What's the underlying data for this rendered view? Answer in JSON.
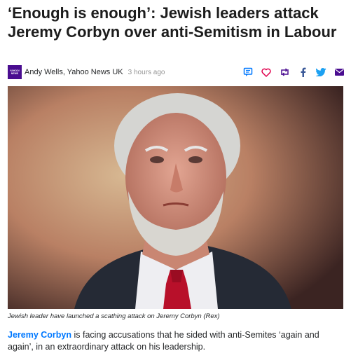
{
  "article": {
    "headline": "‘Enough is enough’: Jewish leaders attack Jeremy Corbyn over anti-Semitism in Labour",
    "provider_logo_text": "YAHOO! NEWS",
    "byline": "Andy Wells, Yahoo News UK",
    "timestamp": "3 hours ago",
    "share_icons": [
      "comment-icon",
      "heart-icon",
      "retweet-icon",
      "facebook-icon",
      "twitter-icon",
      "mail-icon"
    ],
    "accent_color": "#0078ff",
    "image_caption": "Jewish leader have launched a scathing attack on Jeremy Corbyn (Rex)",
    "lead_link": "Jeremy Corbyn",
    "lead_text": " is facing accusations that he sided with anti-Semites ‘again and again’, in an extraordinary attack on his leadership."
  }
}
